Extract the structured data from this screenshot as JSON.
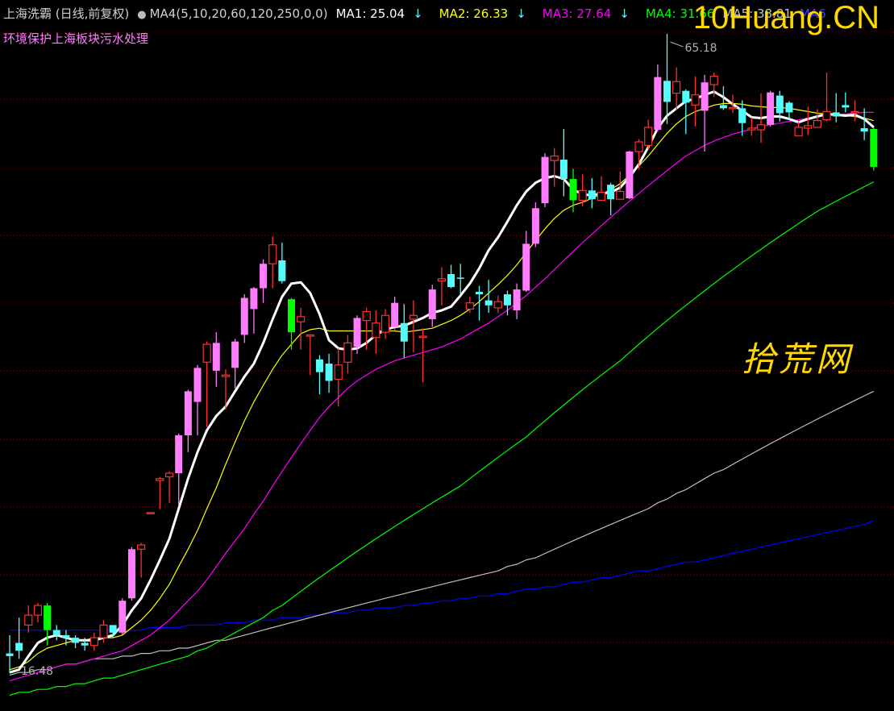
{
  "header": {
    "title": "上海洗霸 (日线,前复权)",
    "formula": "MA4(5,10,20,60,120,250,0,0)",
    "ma1": "MA1: 25.04",
    "ma2": "MA2: 26.33",
    "ma3": "MA3: 27.64",
    "ma4": "MA4: 31.66",
    "ma5": "MA5: 38.81",
    "ma6": "MA6",
    "arrow": "↓"
  },
  "subtitle": "环境保护上海板块污水处理",
  "watermark_brand": "10Huang.CN",
  "watermark_site": "拾荒网",
  "colors": {
    "up": "#ff3030",
    "up_big": "#ff7cff",
    "down": "#54fcfc",
    "down_big": "#00ff00",
    "ma1": "#ffffff",
    "ma2": "#ffff00",
    "ma3": "#ff00ff",
    "ma4": "#00ff00",
    "ma5": "#c0c0c0",
    "ma6": "#0000ff",
    "grid": "#8b0000"
  },
  "chart_data": {
    "type": "candlestick",
    "ylim": [
      15.6,
      66.6
    ],
    "log_scale": true,
    "grid": true,
    "annotations": {
      "high_label": "65.18",
      "low_label": "16.48"
    },
    "candles": [
      [
        17.2,
        17.1,
        16.48,
        17.9
      ],
      [
        17.6,
        17.3,
        17.0,
        18.6
      ],
      [
        18.3,
        18.7,
        18.0,
        19.1
      ],
      [
        18.7,
        19.1,
        18.4,
        19.2
      ],
      [
        19.1,
        18.1,
        17.5,
        19.2
      ],
      [
        18.1,
        17.9,
        17.7,
        18.3
      ],
      [
        17.9,
        17.8,
        17.5,
        18.1
      ],
      [
        17.8,
        17.6,
        17.4,
        17.9
      ],
      [
        17.6,
        17.5,
        17.3,
        17.8
      ],
      [
        17.5,
        17.8,
        17.3,
        18.0
      ],
      [
        17.8,
        18.3,
        17.6,
        18.5
      ],
      [
        18.3,
        18.0,
        17.8,
        18.2
      ],
      [
        18.0,
        19.3,
        17.9,
        19.4
      ],
      [
        19.4,
        21.6,
        19.3,
        21.7
      ],
      [
        21.6,
        21.8,
        20.3,
        21.9
      ],
      [
        23.4,
        23.4,
        23.3,
        23.4
      ],
      [
        25.1,
        25.2,
        23.6,
        25.3
      ],
      [
        25.3,
        25.5,
        23.9,
        25.6
      ],
      [
        25.5,
        27.7,
        23.8,
        27.8
      ],
      [
        27.7,
        30.5,
        26.7,
        30.6
      ],
      [
        29.8,
        32.1,
        27.7,
        32.3
      ],
      [
        32.5,
        33.8,
        28.2,
        34.0
      ],
      [
        31.9,
        33.9,
        30.8,
        34.7
      ],
      [
        31.5,
        31.6,
        29.3,
        32.0
      ],
      [
        32.1,
        34.0,
        30.7,
        34.2
      ],
      [
        34.5,
        37.4,
        33.9,
        37.7
      ],
      [
        36.5,
        38.2,
        34.6,
        38.3
      ],
      [
        38.2,
        40.3,
        37.0,
        40.7
      ],
      [
        40.3,
        42.0,
        38.2,
        42.8
      ],
      [
        40.6,
        38.8,
        38.6,
        42.2
      ],
      [
        37.3,
        34.7,
        33.4,
        37.4
      ],
      [
        35.5,
        35.9,
        33.4,
        36.6
      ],
      [
        34.4,
        34.5,
        31.6,
        34.5
      ],
      [
        32.7,
        31.8,
        30.3,
        33.0
      ],
      [
        32.4,
        31.2,
        30.4,
        33.1
      ],
      [
        31.3,
        32.3,
        29.5,
        33.5
      ],
      [
        32.5,
        33.9,
        31.7,
        34.5
      ],
      [
        33.6,
        35.8,
        33.1,
        36.0
      ],
      [
        35.6,
        36.3,
        33.4,
        36.6
      ],
      [
        34.3,
        35.4,
        33.1,
        36.4
      ],
      [
        34.7,
        36.0,
        34.2,
        36.5
      ],
      [
        35.1,
        37.0,
        34.9,
        37.5
      ],
      [
        35.4,
        34.0,
        32.8,
        36.9
      ],
      [
        35.7,
        36.0,
        33.2,
        37.2
      ],
      [
        34.3,
        34.4,
        31.1,
        35.0
      ],
      [
        35.7,
        38.1,
        35.1,
        38.5
      ],
      [
        38.8,
        39.0,
        36.8,
        40.0
      ],
      [
        39.4,
        38.3,
        38.2,
        40.2
      ],
      [
        39.1,
        39.0,
        37.7,
        40.3
      ],
      [
        36.5,
        37.0,
        36.2,
        37.5
      ],
      [
        37.9,
        37.7,
        35.6,
        38.4
      ],
      [
        37.2,
        36.8,
        36.2,
        38.9
      ],
      [
        36.6,
        37.1,
        36.2,
        37.6
      ],
      [
        37.7,
        36.8,
        36.0,
        38.0
      ],
      [
        36.4,
        38.1,
        35.7,
        38.6
      ],
      [
        38.0,
        42.1,
        37.9,
        43.3
      ],
      [
        42.1,
        45.5,
        41.8,
        46.1
      ],
      [
        46.0,
        50.9,
        45.6,
        51.3
      ],
      [
        50.5,
        51.0,
        47.7,
        51.9
      ],
      [
        50.6,
        48.5,
        46.7,
        54.1
      ],
      [
        48.5,
        46.3,
        45.1,
        49.6
      ],
      [
        46.3,
        47.3,
        45.7,
        49.0
      ],
      [
        47.3,
        46.4,
        45.5,
        48.6
      ],
      [
        46.3,
        47.1,
        46.2,
        48.8
      ],
      [
        47.9,
        46.4,
        44.8,
        48.1
      ],
      [
        46.4,
        47.2,
        46.5,
        49.3
      ],
      [
        46.5,
        51.5,
        46.4,
        51.6
      ],
      [
        51.5,
        52.6,
        49.5,
        52.9
      ],
      [
        52.2,
        54.3,
        51.8,
        55.2
      ],
      [
        54.0,
        60.6,
        53.8,
        62.3
      ],
      [
        60.1,
        57.4,
        54.7,
        66.6
      ],
      [
        58.5,
        60.0,
        56.4,
        61.9
      ],
      [
        58.8,
        57.3,
        53.5,
        59.0
      ],
      [
        57.0,
        58.3,
        54.4,
        60.7
      ],
      [
        56.3,
        59.9,
        51.5,
        60.9
      ],
      [
        59.6,
        60.7,
        58.0,
        61.2
      ],
      [
        57.0,
        56.6,
        56.4,
        59.4
      ],
      [
        56.7,
        56.7,
        56.0,
        58.3
      ],
      [
        56.6,
        54.8,
        53.3,
        57.6
      ],
      [
        54.0,
        54.2,
        53.3,
        55.5
      ],
      [
        54.0,
        54.6,
        52.5,
        58.5
      ],
      [
        54.6,
        58.6,
        54.4,
        58.8
      ],
      [
        58.2,
        56.0,
        55.0,
        58.8
      ],
      [
        57.3,
        56.1,
        55.2,
        57.5
      ],
      [
        53.3,
        54.3,
        53.3,
        55.0
      ],
      [
        54.2,
        54.5,
        53.4,
        56.8
      ],
      [
        54.3,
        55.1,
        54.4,
        56.5
      ],
      [
        55.2,
        56.2,
        55.0,
        61.2
      ],
      [
        56.1,
        55.6,
        54.9,
        58.5
      ],
      [
        57.0,
        56.7,
        56.1,
        58.6
      ],
      [
        56.1,
        56.2,
        55.0,
        57.6
      ],
      [
        54.2,
        53.8,
        52.8,
        56.6
      ],
      [
        54.1,
        49.8,
        49.4,
        54.3
      ]
    ],
    "ma1": [
      16.5,
      16.6,
      17.1,
      17.6,
      17.8,
      17.9,
      17.8,
      17.7,
      17.7,
      17.7,
      17.8,
      17.9,
      18.3,
      18.9,
      19.4,
      20.2,
      21.1,
      22.1,
      23.6,
      25.2,
      26.7,
      28.0,
      28.9,
      29.5,
      30.5,
      31.5,
      32.4,
      33.9,
      35.7,
      37.5,
      38.6,
      38.7,
      37.8,
      36.1,
      34.1,
      33.5,
      33.4,
      33.5,
      33.9,
      34.5,
      34.9,
      35.1,
      35.2,
      35.5,
      35.8,
      36.2,
      36.4,
      36.7,
      37.6,
      38.6,
      39.9,
      41.5,
      42.7,
      44.2,
      45.8,
      47.2,
      48.1,
      48.6,
      48.8,
      48.5,
      47.4,
      46.9,
      46.8,
      47.0,
      47.1,
      47.6,
      48.7,
      50.1,
      52.0,
      54.2,
      55.7,
      56.6,
      57.5,
      57.8,
      58.3,
      58.7,
      58.0,
      57.1,
      56.3,
      55.5,
      55.4,
      55.6,
      55.6,
      55.3,
      54.9,
      55.3,
      55.6,
      55.9,
      55.8,
      55.7,
      55.8,
      55.3,
      54.3
    ],
    "ma2": [
      16.6,
      16.7,
      16.9,
      17.2,
      17.4,
      17.5,
      17.6,
      17.7,
      17.7,
      17.8,
      17.8,
      17.8,
      17.9,
      18.2,
      18.5,
      18.9,
      19.4,
      20.0,
      20.8,
      21.6,
      22.5,
      23.6,
      24.7,
      26.0,
      27.3,
      28.6,
      29.8,
      30.9,
      32.0,
      33.0,
      33.8,
      34.6,
      34.9,
      35.0,
      34.8,
      34.8,
      34.8,
      34.8,
      34.8,
      34.8,
      34.8,
      34.8,
      34.7,
      34.8,
      34.9,
      35.0,
      35.3,
      35.6,
      36.0,
      36.5,
      37.1,
      37.8,
      38.5,
      39.3,
      40.2,
      41.3,
      42.4,
      43.5,
      44.5,
      45.3,
      45.8,
      46.1,
      46.5,
      46.9,
      47.4,
      48.0,
      48.9,
      49.9,
      51.0,
      52.3,
      53.6,
      54.7,
      55.6,
      56.2,
      56.6,
      57.0,
      57.2,
      57.2,
      57.1,
      56.9,
      56.8,
      56.7,
      56.7,
      56.6,
      56.4,
      56.2,
      56.0,
      55.9,
      55.8,
      55.7,
      55.6,
      55.4,
      55.1
    ],
    "ma3": [
      16.2,
      16.3,
      16.4,
      16.5,
      16.6,
      16.7,
      16.8,
      16.8,
      16.9,
      17.0,
      17.1,
      17.2,
      17.3,
      17.5,
      17.7,
      17.9,
      18.2,
      18.5,
      18.9,
      19.3,
      19.7,
      20.2,
      20.8,
      21.4,
      22.0,
      22.6,
      23.3,
      24.0,
      24.8,
      25.6,
      26.4,
      27.2,
      28.0,
      28.8,
      29.5,
      30.1,
      30.7,
      31.2,
      31.6,
      32.0,
      32.3,
      32.6,
      32.8,
      33.0,
      33.2,
      33.4,
      33.6,
      33.9,
      34.2,
      34.6,
      35.0,
      35.4,
      35.9,
      36.4,
      37.0,
      37.6,
      38.3,
      39.0,
      39.8,
      40.6,
      41.4,
      42.2,
      43.0,
      43.8,
      44.6,
      45.4,
      46.2,
      47.0,
      47.8,
      48.6,
      49.4,
      50.2,
      51.0,
      51.6,
      52.2,
      52.7,
      53.1,
      53.5,
      53.8,
      54.1,
      54.4,
      54.6,
      54.8,
      55.0,
      55.2,
      55.4,
      55.6,
      55.7,
      55.8,
      55.9,
      56.0,
      56.1,
      56.1
    ],
    "ma4": [
      15.7,
      15.8,
      15.8,
      15.9,
      15.9,
      16.0,
      16.0,
      16.1,
      16.1,
      16.2,
      16.3,
      16.3,
      16.4,
      16.5,
      16.6,
      16.7,
      16.8,
      16.9,
      17.0,
      17.1,
      17.3,
      17.4,
      17.6,
      17.8,
      18.0,
      18.2,
      18.4,
      18.6,
      18.9,
      19.1,
      19.4,
      19.7,
      20.0,
      20.3,
      20.6,
      20.9,
      21.2,
      21.5,
      21.8,
      22.1,
      22.4,
      22.7,
      23.0,
      23.3,
      23.6,
      23.9,
      24.2,
      24.5,
      24.8,
      25.2,
      25.6,
      26.0,
      26.4,
      26.8,
      27.2,
      27.6,
      28.1,
      28.6,
      29.1,
      29.6,
      30.1,
      30.6,
      31.1,
      31.6,
      32.1,
      32.6,
      33.2,
      33.8,
      34.4,
      35.0,
      35.6,
      36.2,
      36.8,
      37.4,
      38.0,
      38.6,
      39.2,
      39.8,
      40.4,
      41.0,
      41.6,
      42.2,
      42.8,
      43.4,
      44.0,
      44.6,
      45.2,
      45.7,
      46.2,
      46.7,
      47.2,
      47.7,
      48.2
    ],
    "ma5": [
      16.4,
      16.5,
      16.5,
      16.6,
      16.6,
      16.7,
      16.8,
      16.8,
      16.9,
      17.0,
      17.0,
      17.0,
      17.1,
      17.1,
      17.2,
      17.2,
      17.3,
      17.3,
      17.4,
      17.4,
      17.5,
      17.6,
      17.7,
      17.7,
      17.8,
      17.9,
      18.0,
      18.1,
      18.2,
      18.3,
      18.4,
      18.5,
      18.6,
      18.7,
      18.8,
      18.9,
      19.0,
      19.1,
      19.2,
      19.3,
      19.4,
      19.5,
      19.6,
      19.7,
      19.8,
      19.9,
      20.0,
      20.1,
      20.2,
      20.3,
      20.4,
      20.5,
      20.6,
      20.8,
      20.9,
      21.1,
      21.2,
      21.4,
      21.6,
      21.8,
      22.0,
      22.2,
      22.4,
      22.6,
      22.8,
      23.0,
      23.2,
      23.4,
      23.6,
      23.9,
      24.1,
      24.4,
      24.6,
      24.9,
      25.2,
      25.5,
      25.7,
      26.0,
      26.3,
      26.6,
      26.9,
      27.2,
      27.5,
      27.8,
      28.1,
      28.4,
      28.7,
      29.0,
      29.3,
      29.6,
      29.9,
      30.2,
      30.5
    ],
    "ma6": [
      18.1,
      18.1,
      18.1,
      18.1,
      18.1,
      18.1,
      18.1,
      18.1,
      18.1,
      18.1,
      18.1,
      18.1,
      18.1,
      18.1,
      18.1,
      18.2,
      18.2,
      18.2,
      18.2,
      18.3,
      18.3,
      18.3,
      18.3,
      18.4,
      18.4,
      18.4,
      18.5,
      18.5,
      18.5,
      18.6,
      18.6,
      18.6,
      18.7,
      18.7,
      18.8,
      18.8,
      18.8,
      18.9,
      18.9,
      19.0,
      19.0,
      19.0,
      19.1,
      19.1,
      19.2,
      19.2,
      19.3,
      19.3,
      19.4,
      19.4,
      19.5,
      19.5,
      19.6,
      19.6,
      19.7,
      19.8,
      19.8,
      19.9,
      19.9,
      20.0,
      20.1,
      20.1,
      20.2,
      20.3,
      20.3,
      20.4,
      20.5,
      20.6,
      20.6,
      20.7,
      20.8,
      20.9,
      21.0,
      21.0,
      21.1,
      21.2,
      21.3,
      21.4,
      21.5,
      21.6,
      21.7,
      21.8,
      21.9,
      22.0,
      22.1,
      22.2,
      22.3,
      22.4,
      22.5,
      22.6,
      22.7,
      22.8,
      23.0
    ]
  }
}
